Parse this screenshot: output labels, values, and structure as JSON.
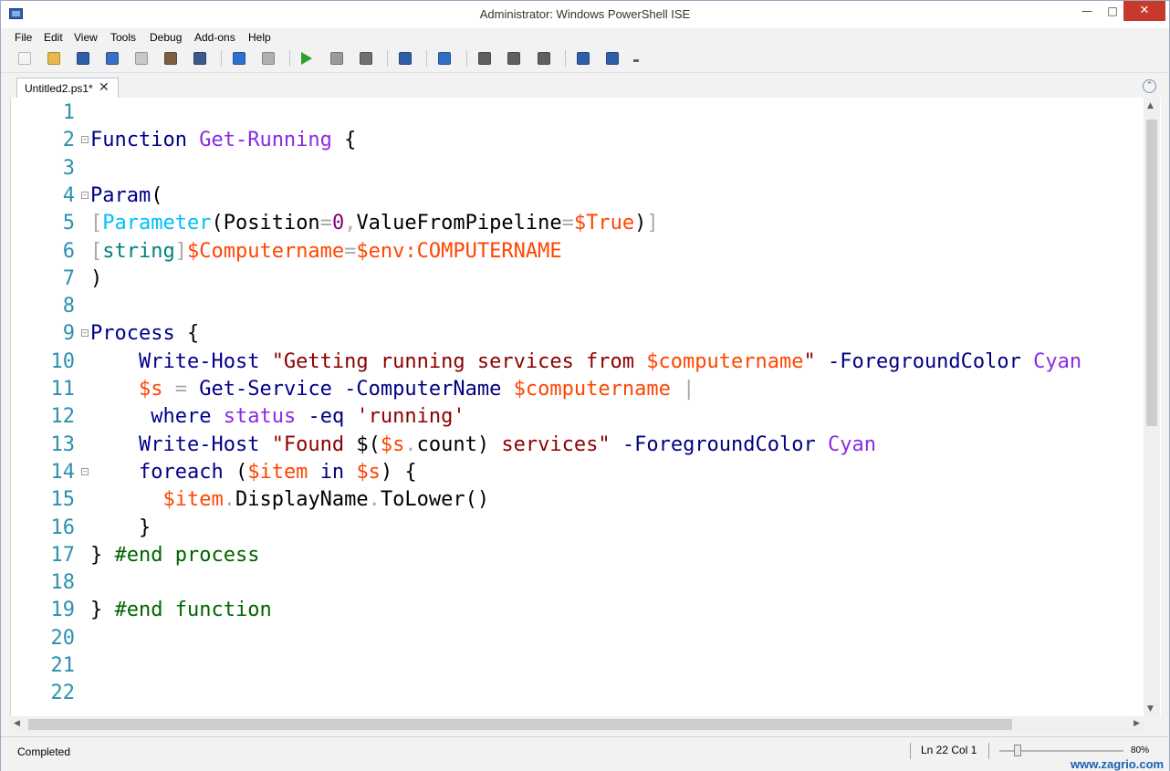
{
  "window": {
    "title": "Administrator: Windows PowerShell ISE",
    "minimize_glyph": "—",
    "maximize_glyph": "□",
    "close_glyph": "✕"
  },
  "menu": [
    "File",
    "Edit",
    "View",
    "Tools",
    "Debug",
    "Add-ons",
    "Help"
  ],
  "toolbar": {
    "buttons": [
      {
        "icon": "new-file-icon",
        "color": "#f5f5f5"
      },
      {
        "icon": "open-folder-icon",
        "color": "#e8b84a"
      },
      {
        "icon": "save-icon",
        "color": "#2f5fa8"
      },
      {
        "icon": "cut-icon",
        "color": "#3a6fc4"
      },
      {
        "icon": "copy-icon",
        "color": "#c8c8c8"
      },
      {
        "icon": "paste-icon",
        "color": "#7a6040"
      },
      {
        "icon": "clear-console-icon",
        "color": "#3a5a8a"
      },
      {
        "icon": "undo-icon",
        "color": "#2f6fd0"
      },
      {
        "icon": "redo-icon",
        "color": "#b0b0b0"
      },
      {
        "icon": "run-script-icon",
        "color": "#2fa02f"
      },
      {
        "icon": "run-selection-icon",
        "color": "#9a9a9a"
      },
      {
        "icon": "stop-icon",
        "color": "#707070"
      },
      {
        "icon": "remote-powershell-icon",
        "color": "#2f5fa8"
      },
      {
        "icon": "powershell-console-icon",
        "color": "#2f6fc4"
      },
      {
        "icon": "show-script-pane-top-icon",
        "color": "#606060"
      },
      {
        "icon": "show-script-pane-right-icon",
        "color": "#606060"
      },
      {
        "icon": "show-script-pane-maximized-icon",
        "color": "#606060"
      },
      {
        "icon": "show-command-window-icon",
        "color": "#2f5fa8"
      },
      {
        "icon": "show-command-addon-icon",
        "color": "#2f5fa8"
      },
      {
        "icon": "toolbar-overflow-icon",
        "color": "#606060"
      }
    ]
  },
  "tab": {
    "label": "Untitled2.ps1*",
    "close_glyph": "✕",
    "collapse_glyph": "⌃"
  },
  "colors": {
    "keyword": "#00008b",
    "command": "#8a2be2",
    "variable": "#ff4500",
    "string": "#8b0000",
    "operator": "#a9a9a9",
    "type": "#008080",
    "attribute": "#00bfff",
    "number": "#800080",
    "comment": "#006400",
    "member": "#000000",
    "parameter": "#000080",
    "plain": "#000000",
    "line_number": "#2b91af"
  },
  "editor": {
    "lines": [
      {
        "n": "1",
        "fold": false,
        "indent": "",
        "tokens": []
      },
      {
        "n": "2",
        "fold": true,
        "indent": "",
        "tokens": [
          {
            "t": "Function",
            "c": "keyword"
          },
          {
            "t": " ",
            "c": "plain"
          },
          {
            "t": "Get-Running",
            "c": "command"
          },
          {
            "t": " {",
            "c": "plain"
          }
        ]
      },
      {
        "n": "3",
        "fold": false,
        "indent": "",
        "tokens": []
      },
      {
        "n": "4",
        "fold": true,
        "indent": "",
        "tokens": [
          {
            "t": "Param",
            "c": "keyword"
          },
          {
            "t": "(",
            "c": "plain"
          }
        ]
      },
      {
        "n": "5",
        "fold": false,
        "indent": "",
        "tokens": [
          {
            "t": "[",
            "c": "operator"
          },
          {
            "t": "Parameter",
            "c": "attribute"
          },
          {
            "t": "(",
            "c": "plain"
          },
          {
            "t": "Position",
            "c": "plain"
          },
          {
            "t": "=",
            "c": "operator"
          },
          {
            "t": "0",
            "c": "number"
          },
          {
            "t": ",",
            "c": "operator"
          },
          {
            "t": "ValueFromPipeline",
            "c": "plain"
          },
          {
            "t": "=",
            "c": "operator"
          },
          {
            "t": "$True",
            "c": "variable"
          },
          {
            "t": ")",
            "c": "plain"
          },
          {
            "t": "]",
            "c": "operator"
          }
        ]
      },
      {
        "n": "6",
        "fold": false,
        "indent": "",
        "tokens": [
          {
            "t": "[",
            "c": "operator"
          },
          {
            "t": "string",
            "c": "type"
          },
          {
            "t": "]",
            "c": "operator"
          },
          {
            "t": "$Computername",
            "c": "variable"
          },
          {
            "t": "=",
            "c": "operator"
          },
          {
            "t": "$env:COMPUTERNAME",
            "c": "variable"
          }
        ]
      },
      {
        "n": "7",
        "fold": false,
        "indent": "",
        "tokens": [
          {
            "t": ")",
            "c": "plain"
          }
        ]
      },
      {
        "n": "8",
        "fold": false,
        "indent": "",
        "tokens": []
      },
      {
        "n": "9",
        "fold": true,
        "indent": "",
        "tokens": [
          {
            "t": "Process",
            "c": "keyword"
          },
          {
            "t": " {",
            "c": "plain"
          }
        ]
      },
      {
        "n": "10",
        "fold": false,
        "indent": "    ",
        "tokens": [
          {
            "t": "Write-Host",
            "c": "keyword"
          },
          {
            "t": " ",
            "c": "plain"
          },
          {
            "t": "\"Getting running services from ",
            "c": "string"
          },
          {
            "t": "$computername",
            "c": "variable"
          },
          {
            "t": "\"",
            "c": "string"
          },
          {
            "t": " -ForegroundColor",
            "c": "parameter"
          },
          {
            "t": " ",
            "c": "plain"
          },
          {
            "t": "Cyan",
            "c": "command"
          }
        ]
      },
      {
        "n": "11",
        "fold": false,
        "indent": "    ",
        "tokens": [
          {
            "t": "$s",
            "c": "variable"
          },
          {
            "t": " ",
            "c": "plain"
          },
          {
            "t": "=",
            "c": "operator"
          },
          {
            "t": " ",
            "c": "plain"
          },
          {
            "t": "Get-Service",
            "c": "keyword"
          },
          {
            "t": " -ComputerName",
            "c": "parameter"
          },
          {
            "t": " ",
            "c": "plain"
          },
          {
            "t": "$computername",
            "c": "variable"
          },
          {
            "t": " ",
            "c": "plain"
          },
          {
            "t": "|",
            "c": "operator"
          }
        ]
      },
      {
        "n": "12",
        "fold": false,
        "indent": "     ",
        "tokens": [
          {
            "t": "where",
            "c": "keyword"
          },
          {
            "t": " ",
            "c": "plain"
          },
          {
            "t": "status",
            "c": "command"
          },
          {
            "t": " -eq",
            "c": "parameter"
          },
          {
            "t": " ",
            "c": "plain"
          },
          {
            "t": "'running'",
            "c": "string"
          }
        ]
      },
      {
        "n": "13",
        "fold": false,
        "indent": "    ",
        "tokens": [
          {
            "t": "Write-Host",
            "c": "keyword"
          },
          {
            "t": " ",
            "c": "plain"
          },
          {
            "t": "\"Found ",
            "c": "string"
          },
          {
            "t": "$(",
            "c": "plain"
          },
          {
            "t": "$s",
            "c": "variable"
          },
          {
            "t": ".",
            "c": "operator"
          },
          {
            "t": "count",
            "c": "member"
          },
          {
            "t": ")",
            "c": "plain"
          },
          {
            "t": " services\"",
            "c": "string"
          },
          {
            "t": " -ForegroundColor",
            "c": "parameter"
          },
          {
            "t": " ",
            "c": "plain"
          },
          {
            "t": "Cyan",
            "c": "command"
          }
        ]
      },
      {
        "n": "14",
        "fold": true,
        "indent": "    ",
        "tokens": [
          {
            "t": "foreach",
            "c": "keyword"
          },
          {
            "t": " (",
            "c": "plain"
          },
          {
            "t": "$item",
            "c": "variable"
          },
          {
            "t": " ",
            "c": "plain"
          },
          {
            "t": "in",
            "c": "keyword"
          },
          {
            "t": " ",
            "c": "plain"
          },
          {
            "t": "$s",
            "c": "variable"
          },
          {
            "t": ") {",
            "c": "plain"
          }
        ]
      },
      {
        "n": "15",
        "fold": false,
        "indent": "      ",
        "tokens": [
          {
            "t": "$item",
            "c": "variable"
          },
          {
            "t": ".",
            "c": "operator"
          },
          {
            "t": "DisplayName",
            "c": "member"
          },
          {
            "t": ".",
            "c": "operator"
          },
          {
            "t": "ToLower",
            "c": "member"
          },
          {
            "t": "()",
            "c": "plain"
          }
        ]
      },
      {
        "n": "16",
        "fold": false,
        "indent": "    ",
        "tokens": [
          {
            "t": "}",
            "c": "plain"
          }
        ]
      },
      {
        "n": "17",
        "fold": false,
        "indent": "",
        "tokens": [
          {
            "t": "}",
            "c": "plain"
          },
          {
            "t": " ",
            "c": "plain"
          },
          {
            "t": "#end process",
            "c": "comment"
          }
        ]
      },
      {
        "n": "18",
        "fold": false,
        "indent": "",
        "tokens": []
      },
      {
        "n": "19",
        "fold": false,
        "indent": "",
        "tokens": [
          {
            "t": "}",
            "c": "plain"
          },
          {
            "t": " ",
            "c": "plain"
          },
          {
            "t": "#end function",
            "c": "comment"
          }
        ]
      },
      {
        "n": "20",
        "fold": false,
        "indent": "",
        "tokens": []
      },
      {
        "n": "21",
        "fold": false,
        "indent": "",
        "tokens": []
      },
      {
        "n": "22",
        "fold": false,
        "indent": "",
        "tokens": []
      }
    ]
  },
  "scrollbars": {
    "up_glyph": "▲",
    "down_glyph": "▼",
    "left_glyph": "◀",
    "right_glyph": "▶"
  },
  "status": {
    "text": "Completed",
    "position": "Ln 22  Col 1",
    "zoom_label": "80%",
    "zoom_level": 0.15,
    "watermark": "www.zagrio.com"
  }
}
